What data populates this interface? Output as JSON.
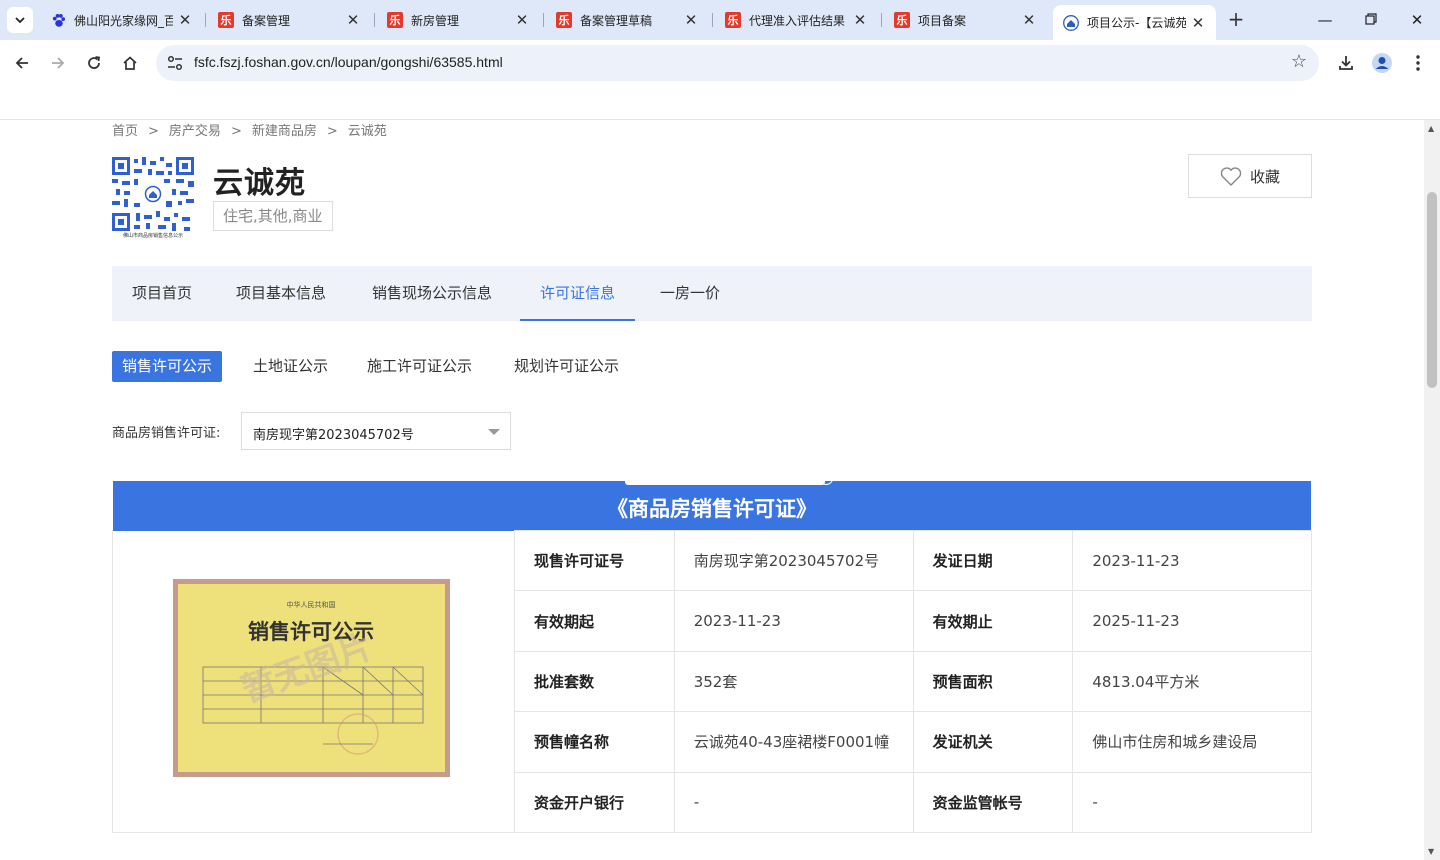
{
  "browser": {
    "tabs": [
      {
        "title": "佛山阳光家缘网_百",
        "icon": "baidu-paw-icon"
      },
      {
        "title": "备案管理",
        "icon": "le-red-icon"
      },
      {
        "title": "新房管理",
        "icon": "le-red-icon"
      },
      {
        "title": "备案管理草稿",
        "icon": "le-red-icon"
      },
      {
        "title": "代理准入评估结果",
        "icon": "le-red-icon"
      },
      {
        "title": "项目备案",
        "icon": "le-red-icon"
      },
      {
        "title": "项目公示-【云诚苑",
        "icon": "foshan-housing-icon",
        "active": true
      }
    ],
    "url": "fsfc.fszj.foshan.gov.cn/loupan/gongshi/63585.html"
  },
  "breadcrumb": [
    "首页",
    "房产交易",
    "新建商品房",
    "云诚苑"
  ],
  "breadcrumb_sep": ">",
  "project": {
    "name": "云诚苑",
    "types": "住宅,其他,商业",
    "favorite_label": "收藏",
    "qr_caption": "佛山市商品房销售信息公示"
  },
  "main_nav": [
    "项目首页",
    "项目基本信息",
    "销售现场公示信息",
    "许可证信息",
    "一房一价"
  ],
  "main_nav_active": "许可证信息",
  "sub_tabs": [
    "销售许可公示",
    "土地证公示",
    "施工许可证公示",
    "规划许可证公示"
  ],
  "sub_tab_active": "销售许可公示",
  "permit_select": {
    "label": "商品房销售许可证:",
    "value": "南房现字第2023045702号"
  },
  "certificate": {
    "banner_title": "《商品房销售许可证》",
    "placeholder_image_text": {
      "heading": "销售许可公示",
      "watermark": "暂无图片",
      "top": "中华人民共和国"
    },
    "rows": [
      {
        "k1": "现售许可证号",
        "v1": "南房现字第2023045702号",
        "k2": "发证日期",
        "v2": "2023-11-23"
      },
      {
        "k1": "有效期起",
        "v1": "2023-11-23",
        "k2": "有效期止",
        "v2": "2025-11-23"
      },
      {
        "k1": "批准套数",
        "v1": "352套",
        "k2": "预售面积",
        "v2": "4813.04平方米"
      },
      {
        "k1": "预售幢名称",
        "v1": "云诚苑40-43座裙楼F0001幢",
        "k2": "发证机关",
        "v2": "佛山市住房和城乡建设局"
      },
      {
        "k1": "资金开户银行",
        "v1": "-",
        "k2": "资金监管帐号",
        "v2": "-"
      }
    ]
  },
  "colors": {
    "accent": "#3a74e0",
    "tabbar": "#dfe8f8",
    "nav_bg": "#eff3f9"
  }
}
